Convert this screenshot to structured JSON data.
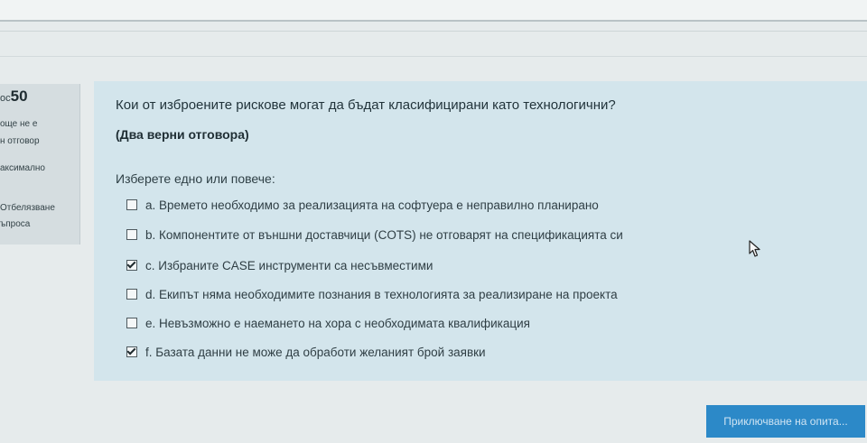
{
  "question_info": {
    "number_prefix": "ос",
    "number": "50",
    "status_line1": "още не е",
    "status_line2": "н отговор",
    "max_label": "аксимално",
    "flag_line1": "Отбелязване",
    "flag_line2": "ъпроса"
  },
  "question": {
    "text": "Кои от изброените рискове могат да бъдат класифицирани като технологични?",
    "note": "(Два верни отговора)",
    "prompt": "Изберете едно или повече:",
    "options": [
      {
        "label": "a. Времето необходимо за реализацията на софтуера е неправилно планирано",
        "checked": false
      },
      {
        "label": "b. Компонентите от външни доставчици (COTS) не отговарят на спецификацията си",
        "checked": false
      },
      {
        "label": "c. Избраните CASE инструменти са несъвместими",
        "checked": true
      },
      {
        "label": "d. Екипът няма необходимите познания в технологията за реализиране на проекта",
        "checked": false
      },
      {
        "label": "e. Невъзможно е наемането на хора с необходимата квалификация",
        "checked": false
      },
      {
        "label": "f. Базата данни не може да обработи желаният брой заявки",
        "checked": true
      }
    ]
  },
  "footer": {
    "finish_label": "Приключване на опита..."
  },
  "colors": {
    "accent": "#2c89c8",
    "card_background": "#d3e5ec",
    "info_background": "#d5dde0"
  },
  "icons": {
    "cursor": "mouse-pointer-icon"
  }
}
